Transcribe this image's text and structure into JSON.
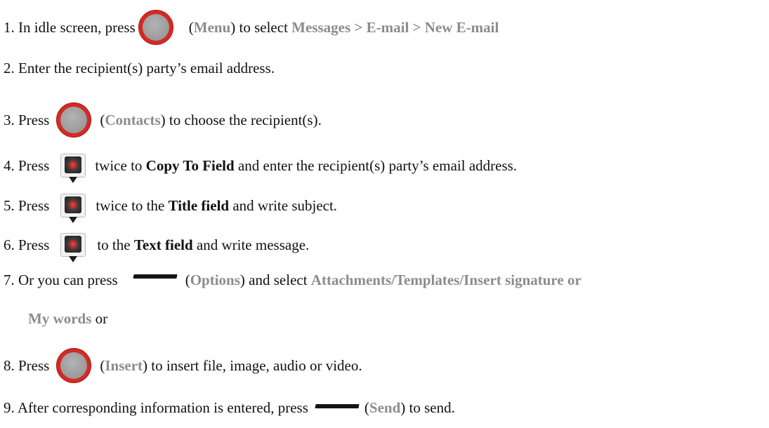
{
  "steps": {
    "s1": {
      "a": "1. In idle screen, press",
      "b": "(",
      "menu": "Menu",
      "c": ") to select ",
      "path": "Messages > E-mail > New E-mail"
    },
    "s2": {
      "a": "2. Enter the recipient(s) party’s email address."
    },
    "s3": {
      "a": "3. Press",
      "b": "(",
      "contacts": "Contacts",
      "c": ") to choose the recipient(s)."
    },
    "s4": {
      "a": "4. Press",
      "b": "twice to ",
      "field": "Copy To Field",
      "c": " and enter the recipient(s) party’s email address."
    },
    "s5": {
      "a": "5. Press",
      "b": "twice to the ",
      "field": "Title field",
      "c": " and write subject."
    },
    "s6": {
      "a": "6. Press",
      "b": "to the ",
      "field": "Text field",
      "c": " and write message."
    },
    "s7": {
      "a": "7. Or you can press",
      "b": "(",
      "options": "Options",
      "c": ") and select ",
      "sel": "Attachments/Templates/Insert signature or"
    },
    "s7b": {
      "words": "My words",
      "or": " or"
    },
    "s8": {
      "a": "8. Press",
      "b": "(",
      "insert": "Insert",
      "c": ") to insert file, image, audio or video."
    },
    "s9": {
      "a": "9. After corresponding information is entered, press",
      "b": "(",
      "send": "Send",
      "c": ") to send."
    }
  },
  "icons": {
    "menu_key": "round-red-key-icon",
    "nav_key": "navigation-down-key-icon",
    "soft_key": "soft-key-bar-icon"
  },
  "colors": {
    "emphasis_grey": "#8c8c8c",
    "key_red": "#d32a26",
    "text": "#111111"
  }
}
